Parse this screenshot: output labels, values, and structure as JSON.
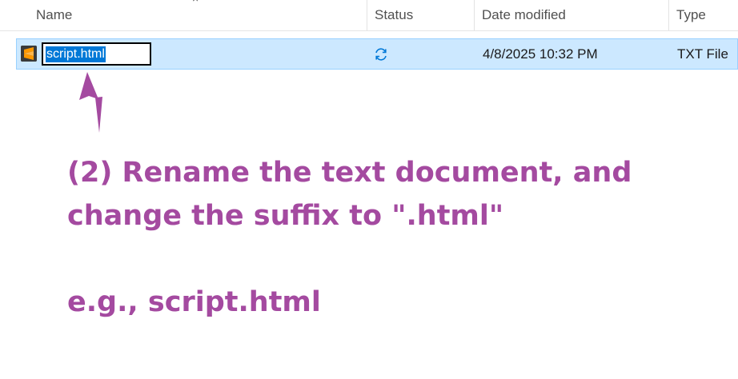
{
  "columns": {
    "name": "Name",
    "status": "Status",
    "date_modified": "Date modified",
    "type": "Type"
  },
  "file_row": {
    "name_edit_value": "script.html",
    "date_modified": "4/8/2025 10:32 PM",
    "type": "TXT File",
    "status_icon": "sync-icon",
    "file_icon": "sublime-text-file-icon"
  },
  "annotation": {
    "line1": "(2) Rename the text document, and",
    "line2": "change the suffix to \".html\"",
    "line3": "e.g., script.html"
  },
  "colors": {
    "annotation": "#a44aa0",
    "selection_row": "#cce8ff",
    "selection_border": "#99d1ff",
    "text_highlight": "#0078d7",
    "status_icon": "#0078d7",
    "file_icon_accent": "#ff9800"
  }
}
